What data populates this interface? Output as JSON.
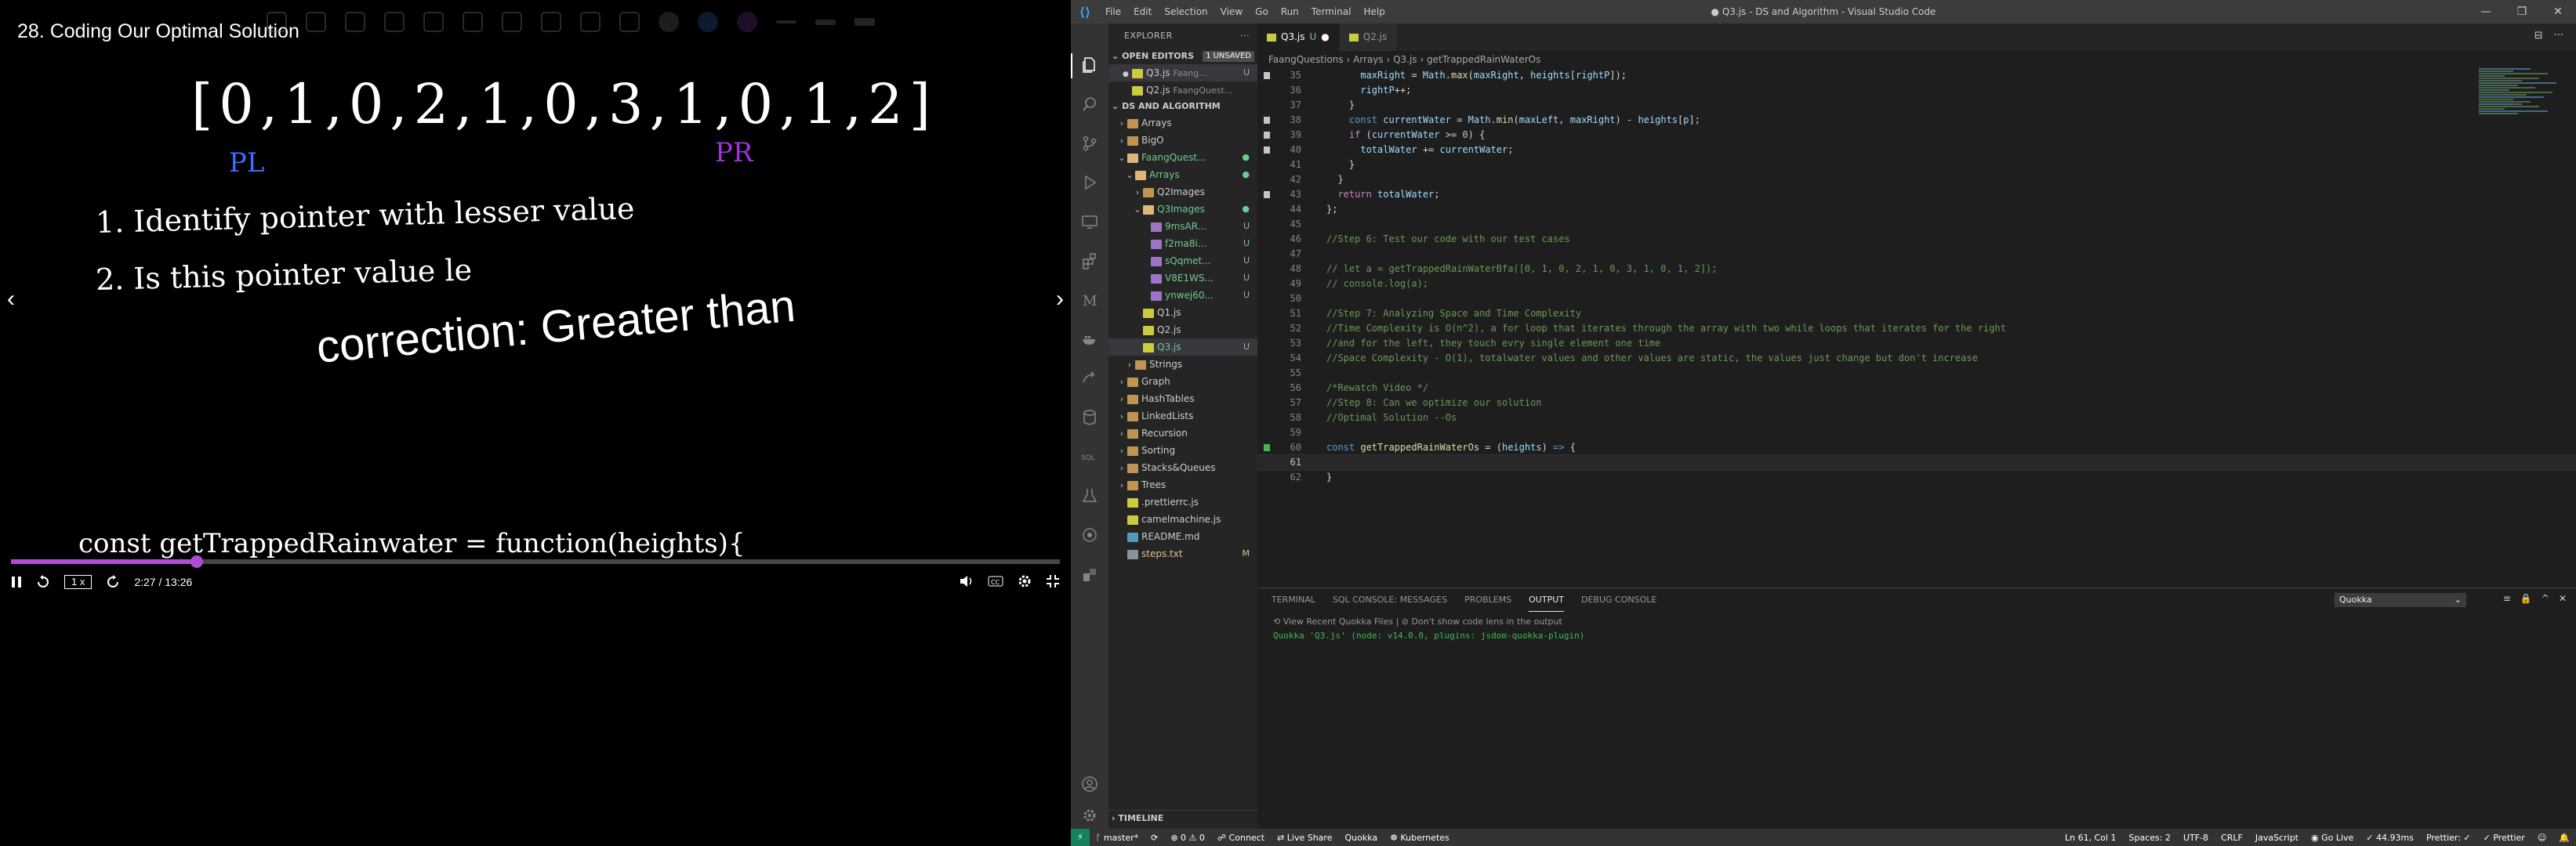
{
  "video": {
    "title": "28. Coding Our Optimal Solution",
    "handwriting": {
      "array": "[0,1,0,2,1,0,3,1,0,1,2]",
      "pl": "PL",
      "pr": "PR",
      "step1": "1. Identify pointer with lesser value",
      "step2": "2. Is this pointer value le",
      "correction": "correction: Greater than",
      "code": "const getTrappedRainwater = function(heights){"
    },
    "arrow_left": "‹",
    "arrow_right": "›",
    "progress": 0.1774,
    "time": "2:27 / 13:26",
    "speed": "1 x",
    "accent_color": "#b04bd6"
  },
  "vscode": {
    "logo": "⟨⟩",
    "menu": [
      "File",
      "Edit",
      "Selection",
      "View",
      "Go",
      "Run",
      "Terminal",
      "Help"
    ],
    "window_title": "● Q3.js - DS and Algorithm - Visual Studio Code",
    "win_controls": [
      "—",
      "❐",
      "✕"
    ],
    "sidebar": {
      "header": "EXPLORER",
      "open_editors": {
        "title": "OPEN EDITORS",
        "badge": "1 UNSAVED",
        "items": [
          {
            "label": "Q3.js",
            "desc": "Faang...",
            "status": "U"
          },
          {
            "label": "Q2.js",
            "desc": "FaangQuest...",
            "status": ""
          }
        ]
      },
      "workspace_title": "DS AND ALGORITHM",
      "tree": [
        {
          "label": "Arrays",
          "type": "folder",
          "chev": "›",
          "status": ""
        },
        {
          "label": "BigO",
          "type": "folder",
          "chev": "›",
          "status": ""
        },
        {
          "label": "FaangQuest...",
          "type": "folder open",
          "chev": "⌄",
          "status": "●"
        },
        {
          "label": "Arrays",
          "type": "folder open",
          "chev": "⌄",
          "status": "●"
        },
        {
          "label": "Q2Images",
          "type": "folder",
          "chev": "›",
          "status": ""
        },
        {
          "label": "Q3Images",
          "type": "folder open",
          "chev": "⌄",
          "status": "●"
        },
        {
          "label": "9msAR...",
          "type": "imgfile",
          "chev": "",
          "status": "U"
        },
        {
          "label": "f2ma8i...",
          "type": "imgfile",
          "chev": "",
          "status": "U"
        },
        {
          "label": "sQqmet...",
          "type": "imgfile",
          "chev": "",
          "status": "U"
        },
        {
          "label": "V8E1WS...",
          "type": "imgfile",
          "chev": "",
          "status": "U"
        },
        {
          "label": "ynwej60...",
          "type": "imgfile",
          "chev": "",
          "status": "U"
        },
        {
          "label": "Q1.js",
          "type": "jsfile",
          "chev": "",
          "status": ""
        },
        {
          "label": "Q2.js",
          "type": "jsfile",
          "chev": "",
          "status": ""
        },
        {
          "label": "Q3.js",
          "type": "jsfile",
          "chev": "",
          "status": "U"
        },
        {
          "label": "Strings",
          "type": "folder",
          "chev": "›",
          "status": ""
        },
        {
          "label": "Graph",
          "type": "folder",
          "chev": "›",
          "status": ""
        },
        {
          "label": "HashTables",
          "type": "folder",
          "chev": "›",
          "status": ""
        },
        {
          "label": "LinkedLists",
          "type": "folder",
          "chev": "›",
          "status": ""
        },
        {
          "label": "Recursion",
          "type": "folder",
          "chev": "›",
          "status": ""
        },
        {
          "label": "Sorting",
          "type": "folder",
          "chev": "›",
          "status": ""
        },
        {
          "label": "Stacks&Queues",
          "type": "folder",
          "chev": "›",
          "status": ""
        },
        {
          "label": "Trees",
          "type": "folder",
          "chev": "›",
          "status": ""
        },
        {
          "label": ".prettierrc.js",
          "type": "jsfile",
          "chev": "",
          "status": ""
        },
        {
          "label": "camelmachine.js",
          "type": "jsfile",
          "chev": "",
          "status": ""
        },
        {
          "label": "README.md",
          "type": "mdfile",
          "chev": "",
          "status": ""
        },
        {
          "label": "steps.txt",
          "type": "txtfile",
          "chev": "",
          "status": "M"
        }
      ],
      "timeline": "TIMELINE"
    },
    "tabs": [
      {
        "label": "Q3.js",
        "status": "U",
        "dirty": "●"
      },
      {
        "label": "Q2.js",
        "status": "",
        "dirty": ""
      }
    ],
    "breadcrumb": "FaangQuestions  ›  Arrays  ›  Q3.js  ›  getTrappedRainWaterOs",
    "code_lines": [
      {
        "num": "35",
        "mark": "gray",
        "tokens": [
          [
            "plain",
            "      "
          ],
          [
            "var",
            "maxRight"
          ],
          [
            "op",
            " = "
          ],
          [
            "var",
            "Math"
          ],
          [
            "op",
            "."
          ],
          [
            "fn",
            "max"
          ],
          [
            "op",
            "("
          ],
          [
            "var",
            "maxRight"
          ],
          [
            "op",
            ", "
          ],
          [
            "var",
            "heights"
          ],
          [
            "op",
            "["
          ],
          [
            "var",
            "rightP"
          ],
          [
            "op",
            "]);"
          ]
        ]
      },
      {
        "num": "36",
        "mark": "",
        "tokens": [
          [
            "plain",
            "      "
          ],
          [
            "var",
            "rightP"
          ],
          [
            "op",
            "++;"
          ]
        ]
      },
      {
        "num": "37",
        "mark": "",
        "tokens": [
          [
            "plain",
            "    }"
          ]
        ]
      },
      {
        "num": "38",
        "mark": "gray",
        "tokens": [
          [
            "plain",
            "    "
          ],
          [
            "kw",
            "const "
          ],
          [
            "var",
            "currentWater"
          ],
          [
            "op",
            " = "
          ],
          [
            "var",
            "Math"
          ],
          [
            "op",
            "."
          ],
          [
            "fn",
            "min"
          ],
          [
            "op",
            "("
          ],
          [
            "var",
            "maxLeft"
          ],
          [
            "op",
            ", "
          ],
          [
            "var",
            "maxRight"
          ],
          [
            "op",
            ") - "
          ],
          [
            "var",
            "heights"
          ],
          [
            "op",
            "["
          ],
          [
            "var",
            "p"
          ],
          [
            "op",
            "];"
          ]
        ]
      },
      {
        "num": "39",
        "mark": "gray",
        "tokens": [
          [
            "plain",
            "    "
          ],
          [
            "ctl",
            "if "
          ],
          [
            "op",
            "("
          ],
          [
            "var",
            "currentWater"
          ],
          [
            "op",
            " >= "
          ],
          [
            "num",
            "0"
          ],
          [
            "op",
            ") {"
          ]
        ]
      },
      {
        "num": "40",
        "mark": "gray",
        "tokens": [
          [
            "plain",
            "      "
          ],
          [
            "var",
            "totalWater"
          ],
          [
            "op",
            " += "
          ],
          [
            "var",
            "currentWater"
          ],
          [
            "op",
            ";"
          ]
        ]
      },
      {
        "num": "41",
        "mark": "",
        "tokens": [
          [
            "plain",
            "    }"
          ]
        ]
      },
      {
        "num": "42",
        "mark": "",
        "tokens": [
          [
            "plain",
            "  }"
          ]
        ]
      },
      {
        "num": "43",
        "mark": "gray",
        "tokens": [
          [
            "plain",
            "  "
          ],
          [
            "ctl",
            "return "
          ],
          [
            "var",
            "totalWater"
          ],
          [
            "op",
            ";"
          ]
        ]
      },
      {
        "num": "44",
        "mark": "",
        "tokens": [
          [
            "plain",
            "};"
          ]
        ]
      },
      {
        "num": "45",
        "mark": "",
        "tokens": [
          [
            "plain",
            ""
          ]
        ]
      },
      {
        "num": "46",
        "mark": "",
        "tokens": [
          [
            "cmt",
            "//Step 6: Test our code with our test cases"
          ]
        ]
      },
      {
        "num": "47",
        "mark": "",
        "tokens": [
          [
            "plain",
            ""
          ]
        ]
      },
      {
        "num": "48",
        "mark": "",
        "tokens": [
          [
            "cmt",
            "// let a = getTrappedRainWaterBfa([0, 1, 0, 2, 1, 0, 3, 1, 0, 1, 2]);"
          ]
        ]
      },
      {
        "num": "49",
        "mark": "",
        "tokens": [
          [
            "cmt",
            "// console.log(a);"
          ]
        ]
      },
      {
        "num": "50",
        "mark": "",
        "tokens": [
          [
            "plain",
            ""
          ]
        ]
      },
      {
        "num": "51",
        "mark": "",
        "tokens": [
          [
            "cmt",
            "//Step 7: Analyzing Space and Time Complexity"
          ]
        ]
      },
      {
        "num": "52",
        "mark": "",
        "tokens": [
          [
            "cmt",
            "//Time Complexity is O(n^2), a for loop that iterates through the array with two while loops that iterates for the right"
          ]
        ]
      },
      {
        "num": "53",
        "mark": "",
        "tokens": [
          [
            "cmt",
            "//and for the left, they touch evry single element one time"
          ]
        ]
      },
      {
        "num": "54",
        "mark": "",
        "tokens": [
          [
            "cmt",
            "//Space Complexity - O(1), totalwater values and other values are static, the values just change but don't increase"
          ]
        ]
      },
      {
        "num": "55",
        "mark": "",
        "tokens": [
          [
            "plain",
            ""
          ]
        ]
      },
      {
        "num": "56",
        "mark": "",
        "tokens": [
          [
            "cmt",
            "/*Rewatch Video */"
          ]
        ]
      },
      {
        "num": "57",
        "mark": "",
        "tokens": [
          [
            "cmt",
            "//Step 8: Can we optimize our solution"
          ]
        ]
      },
      {
        "num": "58",
        "mark": "",
        "tokens": [
          [
            "cmt",
            "//Optimal Solution --Os"
          ]
        ]
      },
      {
        "num": "59",
        "mark": "",
        "tokens": [
          [
            "plain",
            ""
          ]
        ]
      },
      {
        "num": "60",
        "mark": "green",
        "tokens": [
          [
            "kw",
            "const "
          ],
          [
            "fn",
            "getTrappedRainWaterOs"
          ],
          [
            "op",
            " = ("
          ],
          [
            "var",
            "heights"
          ],
          [
            "op",
            ") "
          ],
          [
            "kw",
            "=>"
          ],
          [
            "op",
            " {"
          ]
        ]
      },
      {
        "num": "61",
        "mark": "",
        "tokens": [
          [
            "plain",
            ""
          ]
        ],
        "current": true
      },
      {
        "num": "62",
        "mark": "",
        "tokens": [
          [
            "op",
            "}"
          ]
        ]
      }
    ],
    "panel": {
      "tabs": [
        "TERMINAL",
        "SQL CONSOLE: MESSAGES",
        "PROBLEMS",
        "OUTPUT",
        "DEBUG CONSOLE"
      ],
      "active_tab": "OUTPUT",
      "select": "Quokka",
      "codelens": "⟲ View Recent Quokka Files | ⊘ Don't show code lens in the output",
      "output": "Quokka 'Q3.js' (node: v14.0.0, plugins: jsdom-quokka-plugin)"
    },
    "statusbar": {
      "left": [
        "⚡",
        "ᚴ master*",
        "⟳",
        "⊗ 0 ⚠ 0",
        "☍ Connect",
        "⇄ Live Share",
        "Quokka",
        "☸ Kubernetes"
      ],
      "right": [
        "Ln 61, Col 1",
        "Spaces: 2",
        "UTF-8",
        "CRLF",
        "JavaScript",
        "◉ Go Live",
        "✓ 44.93ms",
        "Prettier: ✓",
        "✓ Prettier",
        "☺",
        "🔔"
      ]
    },
    "colors": {
      "accent": "#007acc",
      "git_untracked": "#73c991",
      "git_modified": "#e2c08d"
    }
  }
}
